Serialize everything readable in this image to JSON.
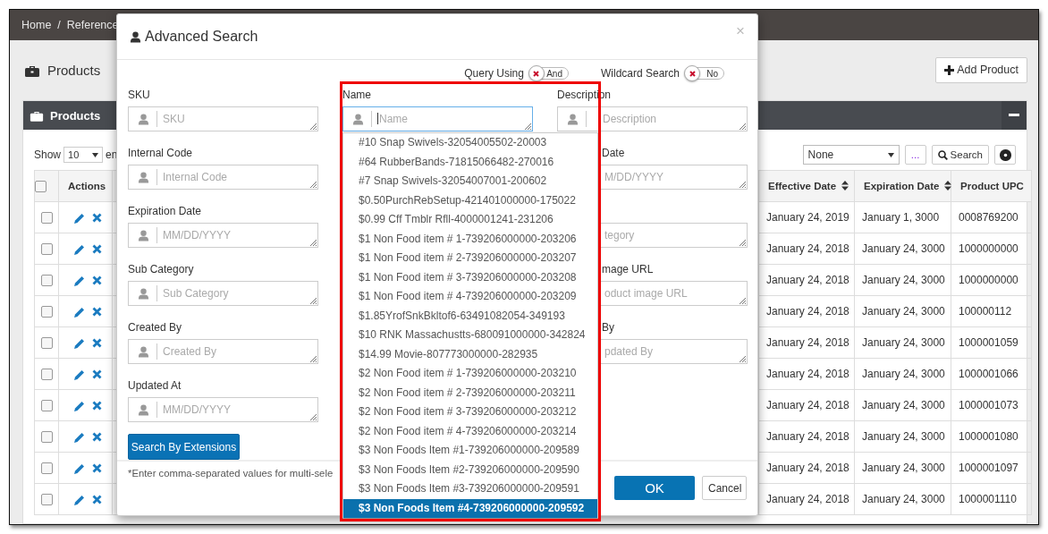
{
  "breadcrumb": {
    "items": [
      "Home",
      "Reference"
    ],
    "separator": "/"
  },
  "page": {
    "title": "Products",
    "add_button": "Add Product"
  },
  "panel": {
    "title": "Products",
    "show_label": "Show",
    "page_size": "10",
    "entries_label": "en",
    "filter_select": "None",
    "more_button": "...",
    "search_button": "Search"
  },
  "table": {
    "header_checked": false,
    "columns": [
      {
        "label": "Actions",
        "sortable": false
      },
      {
        "label": "Effective Date",
        "sortable": true
      },
      {
        "label": "Expiration Date",
        "sortable": true
      },
      {
        "label": "Product UPC",
        "sortable": false
      }
    ],
    "rows": [
      {
        "checked": false,
        "effective": "January 24, 2019",
        "expiration": "January 1, 3000",
        "upc": "0008769200"
      },
      {
        "checked": false,
        "effective": "January 24, 2018",
        "expiration": "January 24, 3000",
        "upc": "1000000000"
      },
      {
        "checked": false,
        "effective": "January 24, 2018",
        "expiration": "January 24, 3000",
        "upc": "1000000000"
      },
      {
        "checked": false,
        "effective": "January 24, 2018",
        "expiration": "January 24, 3000",
        "upc": "100000112"
      },
      {
        "checked": false,
        "effective": "January 24, 2018",
        "expiration": "January 24, 3000",
        "upc": "1000001059"
      },
      {
        "checked": false,
        "effective": "January 24, 2018",
        "expiration": "January 24, 3000",
        "upc": "1000001066"
      },
      {
        "checked": false,
        "effective": "January 24, 2018",
        "expiration": "January 24, 3000",
        "upc": "1000001073"
      },
      {
        "checked": false,
        "effective": "January 24, 2018",
        "expiration": "January 24, 3000",
        "upc": "1000001080"
      },
      {
        "checked": false,
        "effective": "January 24, 2018",
        "expiration": "January 24, 3000",
        "upc": "1000001097"
      },
      {
        "checked": false,
        "effective": "January 24, 2018",
        "expiration": "January 24, 3000",
        "upc": "1000001110"
      }
    ]
  },
  "modal": {
    "title": "Advanced Search",
    "close": "×",
    "toggles": [
      {
        "label": "Query Using",
        "value": "And",
        "on": false
      },
      {
        "label": "Wildcard Search",
        "value": "No",
        "on": false
      }
    ],
    "fields_left": [
      {
        "label": "SKU",
        "placeholder": "SKU"
      },
      {
        "label": "Internal Code",
        "placeholder": "Internal Code"
      },
      {
        "label": "Expiration Date",
        "placeholder": "MM/DD/YYYY"
      },
      {
        "label": "Sub Category",
        "placeholder": "Sub Category"
      },
      {
        "label": "Created By",
        "placeholder": "Created By"
      },
      {
        "label": "Updated At",
        "placeholder": "MM/DD/YYYY"
      }
    ],
    "fields_right": [
      {
        "kind": "full",
        "label": "Description",
        "placeholder": "Description"
      },
      {
        "kind": "partial",
        "label": "Date",
        "placeholder": "M/DD/YYYY"
      },
      {
        "kind": "partial",
        "placeholder": "tegory"
      },
      {
        "kind": "partial",
        "label": "mage URL",
        "placeholder": "oduct image URL"
      },
      {
        "kind": "partial",
        "label": "By",
        "placeholder": "pdated By"
      }
    ],
    "extensions_button": "Search By Extensions",
    "footnote": "*Enter comma-separated values for multi-sele",
    "ok_button": "OK",
    "cancel_button": "Cancel"
  },
  "name_field": {
    "label": "Name",
    "placeholder": "Name",
    "focused": true,
    "options": [
      {
        "text": "#10 Snap Swivels-32054005502-20003",
        "selected": false
      },
      {
        "text": "#64 RubberBands-71815066482-270016",
        "selected": false
      },
      {
        "text": "#7 Snap Swivels-32054007001-200602",
        "selected": false
      },
      {
        "text": "$0.50PurchRebSetup-421401000000-175022",
        "selected": false
      },
      {
        "text": "$0.99 Cff Tmblr Rfll-4000001241-231206",
        "selected": false
      },
      {
        "text": "$1 Non Food item # 1-739206000000-203206",
        "selected": false
      },
      {
        "text": "$1 Non Food item # 2-739206000000-203207",
        "selected": false
      },
      {
        "text": "$1 Non Food item # 3-739206000000-203208",
        "selected": false
      },
      {
        "text": "$1 Non Food item # 4-739206000000-203209",
        "selected": false
      },
      {
        "text": "$1.85YrofSnkBkltof6-63491082054-349193",
        "selected": false
      },
      {
        "text": "$10 RNK Massachustts-680091000000-342824",
        "selected": false
      },
      {
        "text": "$14.99 Movie-807773000000-282935",
        "selected": false
      },
      {
        "text": "$2 Non Food item # 1-739206000000-203210",
        "selected": false
      },
      {
        "text": "$2 Non Food item # 2-739206000000-203211",
        "selected": false
      },
      {
        "text": "$2 Non Food item # 3-739206000000-203212",
        "selected": false
      },
      {
        "text": "$2 Non Food item # 4-739206000000-203214",
        "selected": false
      },
      {
        "text": "$3 Non Foods Item #1-739206000000-209589",
        "selected": false
      },
      {
        "text": "$3 Non Foods Item #2-739206000000-209590",
        "selected": false
      },
      {
        "text": "$3 Non Foods Item #3-739206000000-209591",
        "selected": false
      },
      {
        "text": "$3 Non Foods Item #4-739206000000-209592",
        "selected": true
      }
    ]
  }
}
